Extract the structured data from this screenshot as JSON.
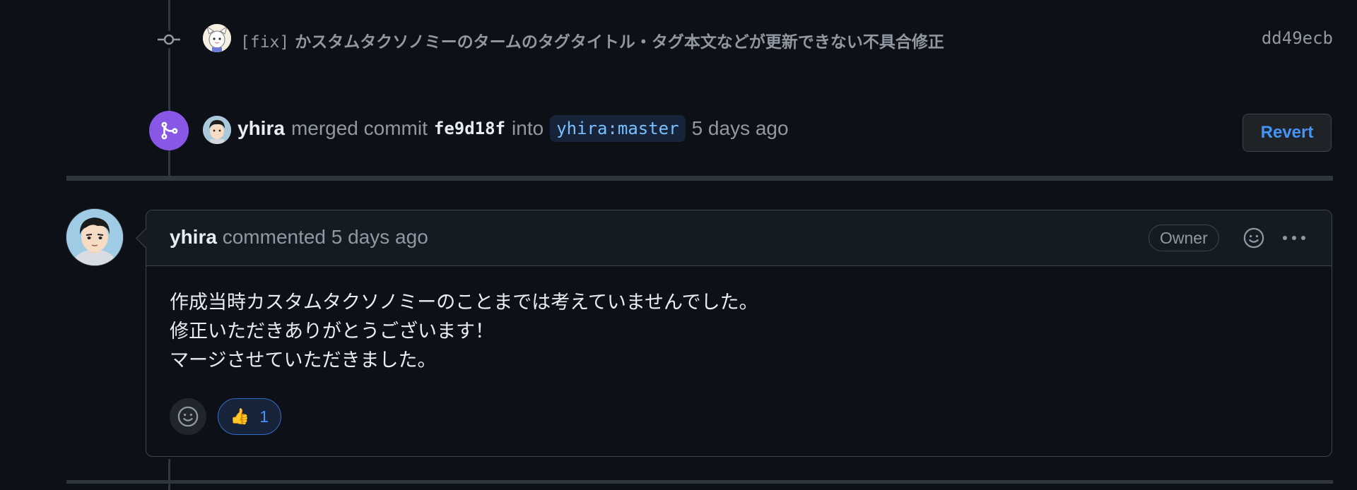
{
  "commit": {
    "prefix": "[fix]",
    "message": " かスタムタクソノミーのタームのタグタイトル・タグ本文などが更新できない不具合修正",
    "sha": "dd49ecb"
  },
  "merge": {
    "author": "yhira",
    "merged_text": "merged commit",
    "sha": "fe9d18f",
    "into_text": "into",
    "branch": "yhira:master",
    "time": "5 days ago",
    "revert_label": "Revert",
    "badge_color": "#8957e5"
  },
  "comment": {
    "author": "yhira",
    "action_text": " commented 5 days ago",
    "owner_label": "Owner",
    "body_lines": [
      "作成当時カスタムタクソノミーのことまでは考えていませんでした。",
      "修正いただきありがとうございます！",
      "マージさせていただきました。"
    ],
    "reaction": {
      "emoji": "👍",
      "count": "1"
    }
  },
  "icons": [
    "git-commit-icon",
    "git-merge-icon",
    "smiley-icon",
    "kebab-horizontal-icon",
    "thumbs-up-icon"
  ]
}
